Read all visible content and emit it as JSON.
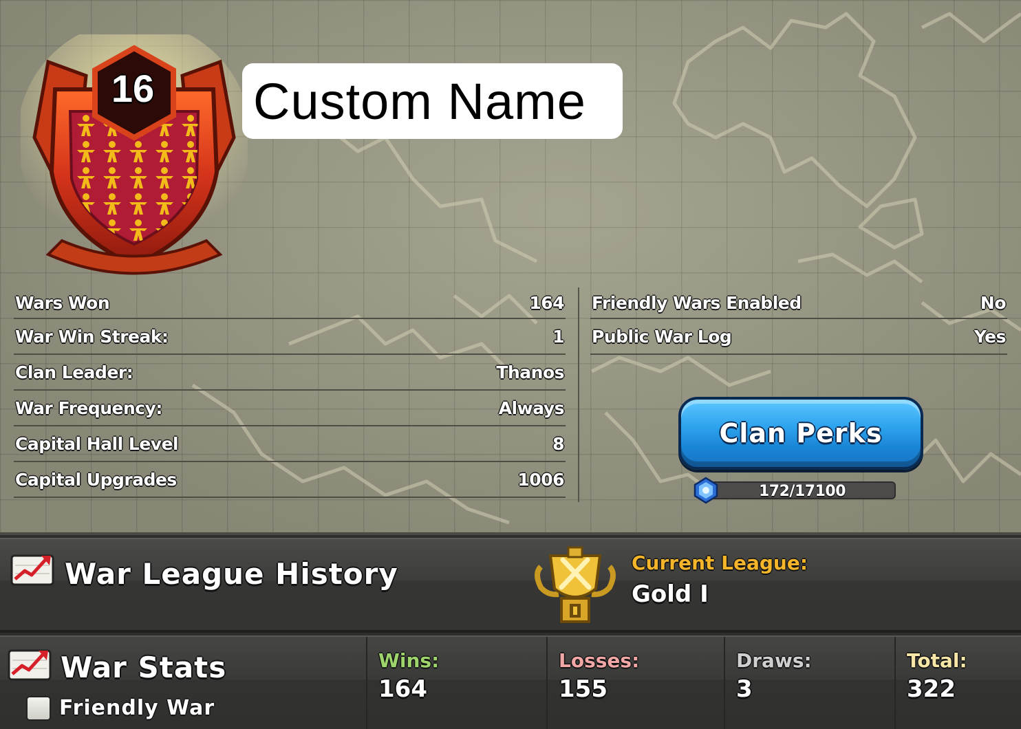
{
  "clan": {
    "name": "Custom Name",
    "level": "16"
  },
  "info_left": [
    {
      "label": "Wars Won",
      "value": "164"
    },
    {
      "label": "War Win Streak:",
      "value": "1"
    },
    {
      "label": "Clan Leader:",
      "value": "Thanos"
    },
    {
      "label": "War Frequency:",
      "value": "Always"
    },
    {
      "label": "Capital Hall Level",
      "value": "8"
    },
    {
      "label": "Capital Upgrades",
      "value": "1006"
    }
  ],
  "info_right": [
    {
      "label": "Friendly Wars Enabled",
      "value": "No"
    },
    {
      "label": "Public War Log",
      "value": "Yes"
    }
  ],
  "perks": {
    "button_label": "Clan Perks",
    "progress_text": "172/17100",
    "progress_fraction": 0.01
  },
  "war_league": {
    "title": "War League History",
    "current_label": "Current League:",
    "current_value": "Gold I"
  },
  "war_stats": {
    "title": "War Stats",
    "friendly_label": "Friendly War",
    "stats": [
      {
        "label": "Wins:",
        "value": "164",
        "color": "#9ed46b"
      },
      {
        "label": "Losses:",
        "value": "155",
        "color": "#f2a7a7"
      },
      {
        "label": "Draws:",
        "value": "3",
        "color": "#cfcfcf"
      },
      {
        "label": "Total:",
        "value": "322",
        "color": "#f6e7a8"
      }
    ]
  },
  "icons": {
    "badge": "clan-badge-icon",
    "gem": "capital-gem-icon",
    "trend": "trend-chart-icon",
    "trophy": "gold-league-trophy-icon"
  }
}
